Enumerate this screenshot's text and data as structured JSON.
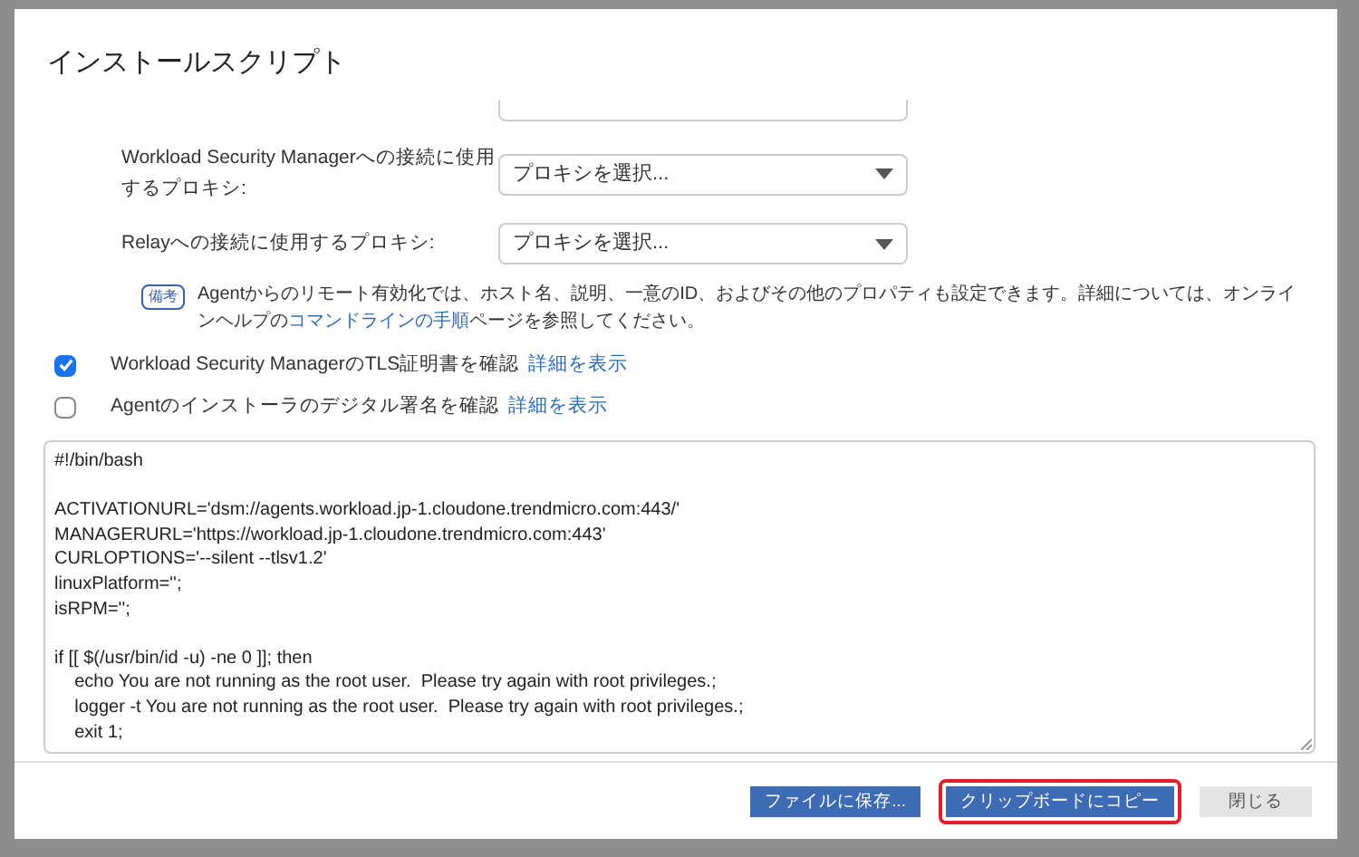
{
  "dialog": {
    "title": "インストールスクリプト"
  },
  "proxy_fields": [
    {
      "label": "Workload Security Managerへの接続に使用するプロキシ:",
      "placeholder": "プロキシを選択..."
    },
    {
      "label": "Relayへの接続に使用するプロキシ:",
      "placeholder": "プロキシを選択..."
    }
  ],
  "note": {
    "badge": "備考",
    "text_before": "Agentからのリモート有効化では、ホスト名、説明、一意のID、およびその他のプロパティも設定できます。詳細については、オンラインヘルプの",
    "link": "コマンドラインの手順",
    "text_after": "ページを参照してください。"
  },
  "checkboxes": [
    {
      "label": "Workload Security ManagerのTLS証明書を確認",
      "link": "詳細を表示",
      "checked": true
    },
    {
      "label": "Agentのインストーラのデジタル署名を確認",
      "link": "詳細を表示",
      "checked": false
    }
  ],
  "script_blocks": [
    [
      "#!/bin/bash"
    ],
    [
      "ACTIVATIONURL='dsm://agents.workload.jp-1.cloudone.trendmicro.com:443/'",
      "MANAGERURL='https://workload.jp-1.cloudone.trendmicro.com:443'",
      "CURLOPTIONS='--silent --tlsv1.2'",
      "linuxPlatform='';",
      "isRPM='';"
    ],
    [
      "if [[ $(/usr/bin/id -u) -ne 0 ]]; then",
      "    echo You are not running as the root user.  Please try again with root privileges.;",
      "    logger -t You are not running as the root user.  Please try again with root privileges.;",
      "    exit 1;"
    ]
  ],
  "buttons": [
    {
      "label": "ファイルに保存...",
      "kind": "primary",
      "highlighted": false
    },
    {
      "label": "クリップボードにコピー",
      "kind": "primary",
      "highlighted": true
    },
    {
      "label": "閉じる",
      "kind": "secondary",
      "highlighted": false
    }
  ]
}
